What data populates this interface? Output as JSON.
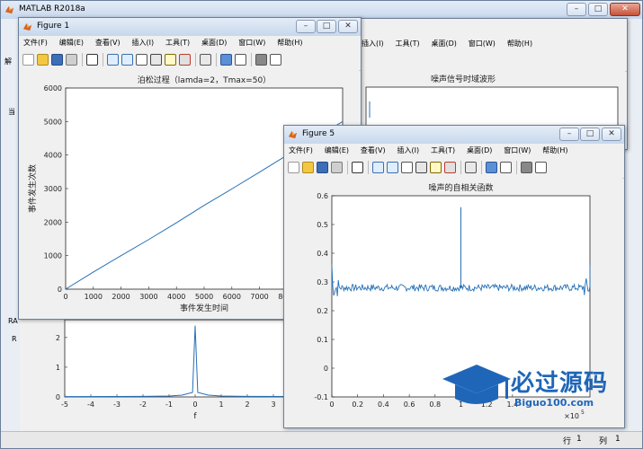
{
  "matlab": {
    "title": "MATLAB R2018a",
    "side_letters": [
      "解",
      "当",
      "RA",
      "R"
    ],
    "status": {
      "row_label": "行",
      "row_value": "1",
      "col_label": "列",
      "col_value": "1"
    }
  },
  "figure_menu": [
    "文件(F)",
    "编辑(E)",
    "查看(V)",
    "插入(I)",
    "工具(T)",
    "桌面(D)",
    "窗口(W)",
    "帮助(H)"
  ],
  "figure1": {
    "title": "Figure 1"
  },
  "figure5": {
    "title": "Figure 5"
  },
  "watermark": {
    "brand": "必过源码",
    "url": "Biguo100.com"
  },
  "chart_data": [
    {
      "type": "line",
      "title": "泊松过程（lamda=2，Tmax=50）",
      "xlabel": "事件发生时间",
      "ylabel": "事件发生次数",
      "xlim": [
        0,
        10000
      ],
      "ylim": [
        0,
        6000
      ],
      "xticks": [
        0,
        1000,
        2000,
        3000,
        4000,
        5000,
        6000,
        7000,
        8000
      ],
      "yticks": [
        0,
        1000,
        2000,
        3000,
        4000,
        5000,
        6000
      ],
      "x": [
        0,
        1000,
        2000,
        3000,
        4000,
        5000,
        6000,
        7000,
        8000,
        9000,
        10000
      ],
      "y": [
        0,
        510,
        1000,
        1480,
        1980,
        2500,
        2990,
        3490,
        4000,
        4500,
        5000
      ],
      "grid": false
    },
    {
      "type": "line",
      "title": "噪声信号时域波形",
      "xlabel": "",
      "ylabel": "",
      "partially_hidden": true
    },
    {
      "type": "line",
      "title": "",
      "xlabel": "f",
      "ylabel": "",
      "xlim": [
        -5,
        5
      ],
      "ylim": [
        0,
        2.6
      ],
      "xticks": [
        -5,
        -4,
        -3,
        -2,
        -1,
        0,
        1,
        2,
        3
      ],
      "yticks": [
        0,
        1,
        2
      ],
      "series": [
        {
          "x": [
            -5,
            -2,
            -1,
            -0.5,
            -0.1,
            0,
            0.1,
            0.5,
            1,
            2,
            5
          ],
          "y": [
            0.01,
            0.02,
            0.03,
            0.06,
            0.15,
            2.4,
            0.15,
            0.06,
            0.03,
            0.02,
            0.01
          ]
        }
      ],
      "grid": false
    },
    {
      "type": "line",
      "title": "噪声的自相关函数",
      "xlabel": "",
      "ylabel": "",
      "xlim": [
        0,
        2
      ],
      "ylim": [
        -0.1,
        0.6
      ],
      "xticks": [
        0,
        0.2,
        0.4,
        0.6,
        0.8,
        1,
        1.2,
        1.4
      ],
      "yticks": [
        -0.1,
        0,
        0.1,
        0.2,
        0.3,
        0.4,
        0.5,
        0.6
      ],
      "x_exponent": "×10",
      "x_exponent_power": "5",
      "baseline": 0.28,
      "peak": {
        "x": 1,
        "y": 0.56
      },
      "edge_peaks": [
        {
          "x": 0,
          "y": 0.36
        },
        {
          "x": 2,
          "y": 0.36
        }
      ],
      "grid": false
    }
  ],
  "colors": {
    "line": "#2670b6",
    "title_bar": "#c7d7ec",
    "axes_bg": "#ffffff",
    "watermark": "#1f66b8"
  }
}
